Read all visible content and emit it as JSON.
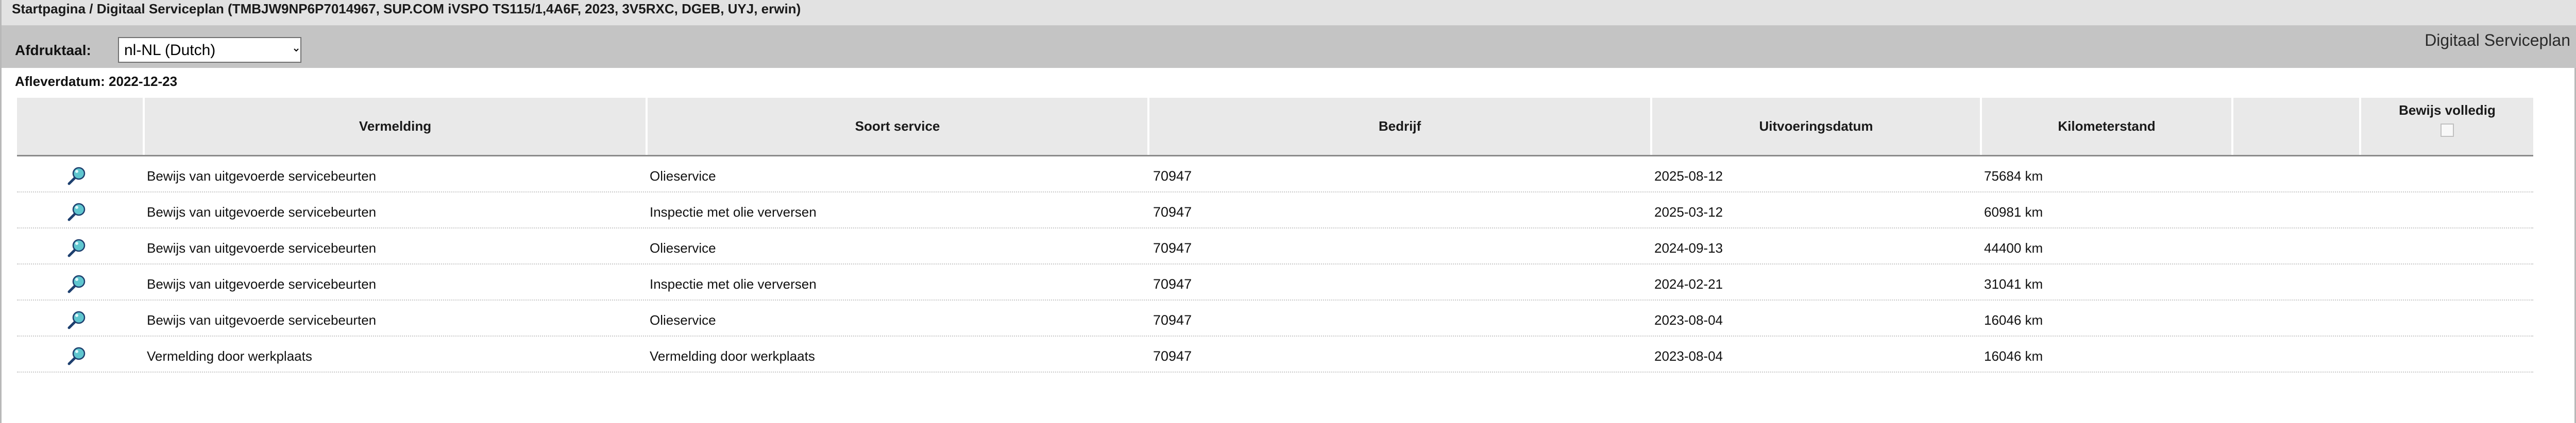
{
  "breadcrumb": {
    "home": "Startpagina",
    "separator": " / ",
    "current": "Digitaal Serviceplan (TMBJW9NP6P7014967, SUP.COM iVSPO TS115/1,4A6F, 2023, 3V5RXC, DGEB, UYJ, erwin)"
  },
  "toolbar": {
    "print_language_label": "Afdruktaal:",
    "print_language_value": "nl-NL (Dutch)",
    "module_title": "Digitaal Serviceplan"
  },
  "delivery": {
    "text": "Afleverdatum: 2022-12-23"
  },
  "table": {
    "columns": [
      "",
      "Vermelding",
      "Soort service",
      "Bedrijf",
      "Uitvoeringsdatum",
      "Kilometerstand",
      "",
      "Bewijs volledig"
    ],
    "rows": [
      {
        "icon": "magnifier-icon",
        "entry": "Bewijs van uitgevoerde servicebeurten",
        "service": "Olieservice",
        "company": "70947",
        "date": "2025-08-12",
        "mileage": "75684 km"
      },
      {
        "icon": "magnifier-icon",
        "entry": "Bewijs van uitgevoerde servicebeurten",
        "service": "Inspectie met olie verversen",
        "company": "70947",
        "date": "2025-03-12",
        "mileage": "60981 km"
      },
      {
        "icon": "magnifier-icon",
        "entry": "Bewijs van uitgevoerde servicebeurten",
        "service": "Olieservice",
        "company": "70947",
        "date": "2024-09-13",
        "mileage": "44400 km"
      },
      {
        "icon": "magnifier-icon",
        "entry": "Bewijs van uitgevoerde servicebeurten",
        "service": "Inspectie met olie verversen",
        "company": "70947",
        "date": "2024-02-21",
        "mileage": "31041 km"
      },
      {
        "icon": "magnifier-icon",
        "entry": "Bewijs van uitgevoerde servicebeurten",
        "service": "Olieservice",
        "company": "70947",
        "date": "2023-08-04",
        "mileage": "16046 km"
      },
      {
        "icon": "magnifier-icon",
        "entry": "Vermelding door werkplaats",
        "service": "Vermelding door werkplaats",
        "company": "70947",
        "date": "2023-08-04",
        "mileage": "16046 km"
      }
    ]
  },
  "colors": {
    "header_bar": "#e2e2e2",
    "toolbar": "#c4c4c4",
    "table_header": "#e9e9e9",
    "magnifier_lens": "#5fc6cf"
  }
}
